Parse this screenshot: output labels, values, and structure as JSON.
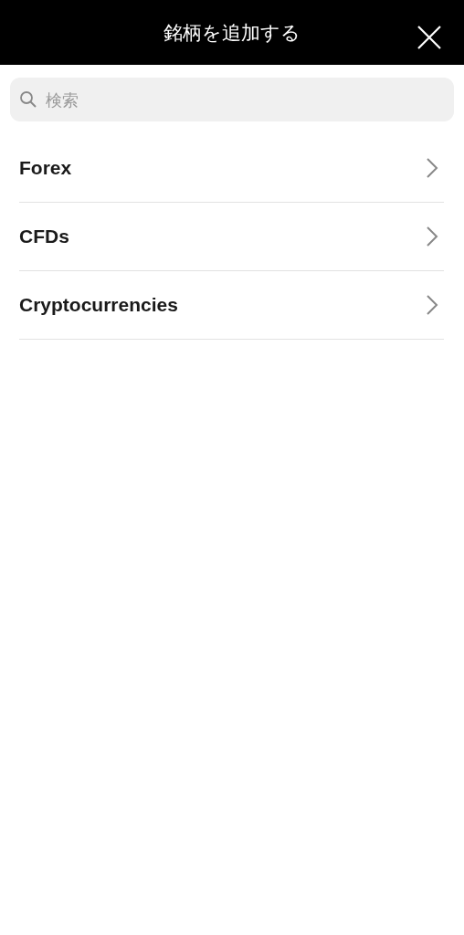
{
  "header": {
    "title": "銘柄を追加する"
  },
  "search": {
    "placeholder": "検索"
  },
  "items": [
    {
      "label": "Forex"
    },
    {
      "label": "CFDs"
    },
    {
      "label": "Cryptocurrencies"
    }
  ]
}
